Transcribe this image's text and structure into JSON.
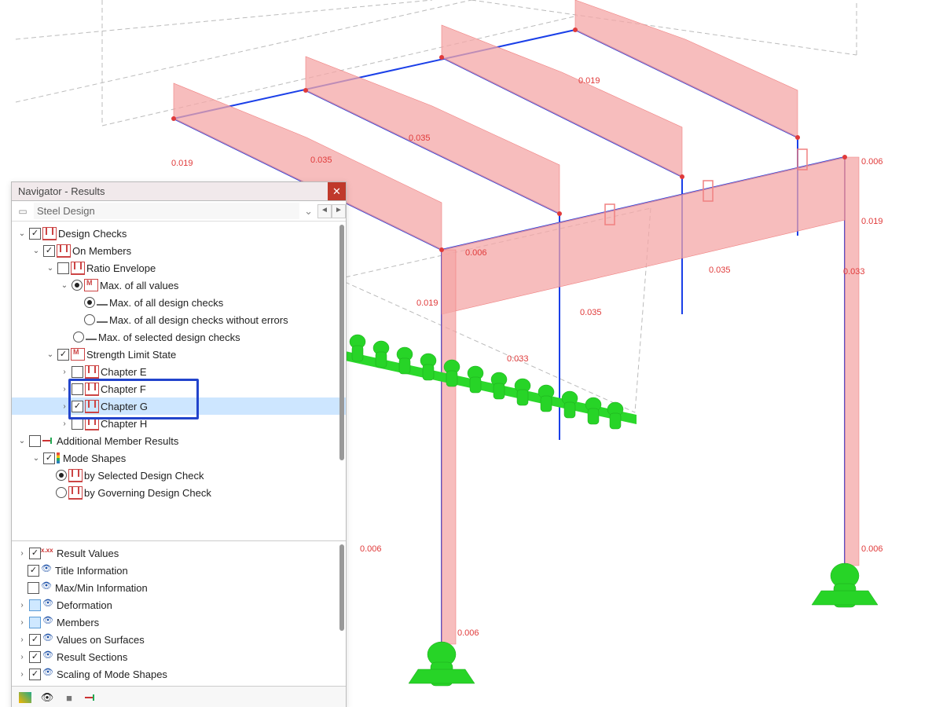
{
  "navigator": {
    "title": "Navigator - Results",
    "selector": "Steel Design"
  },
  "tree": {
    "design_checks": "Design Checks",
    "on_members": "On Members",
    "ratio_envelope": "Ratio Envelope",
    "max_all_values": "Max. of all values",
    "max_all_checks": "Max. of all design checks",
    "max_all_checks_noerr": "Max. of all design checks without errors",
    "max_selected_checks": "Max. of selected design checks",
    "strength_limit": "Strength Limit State",
    "chapter_e": "Chapter E",
    "chapter_f": "Chapter F",
    "chapter_g": "Chapter G",
    "chapter_h": "Chapter H",
    "additional_results": "Additional Member Results",
    "mode_shapes": "Mode Shapes",
    "by_selected": "by Selected Design Check",
    "by_governing": "by Governing Design Check",
    "result_values": "Result Values",
    "title_info": "Title Information",
    "maxmin_info": "Max/Min Information",
    "deformation": "Deformation",
    "members": "Members",
    "values_on_surfaces": "Values on Surfaces",
    "result_sections": "Result Sections",
    "scaling_mode_shapes": "Scaling of Mode Shapes"
  },
  "viewport_labels": {
    "v019_a": "0.019",
    "v019_b": "0.019",
    "v035_a": "0.035",
    "v035_b": "0.035",
    "v006_a": "0.006",
    "v006_b": "0.006",
    "v019_c": "0.019",
    "v033_a": "0.033",
    "v019_d": "0.019",
    "v035_c": "0.035",
    "v035_d": "0.035",
    "v033_b": "0.033",
    "v006_c": "0.006",
    "v006_d": "0.006",
    "v006_e": "0.006"
  }
}
